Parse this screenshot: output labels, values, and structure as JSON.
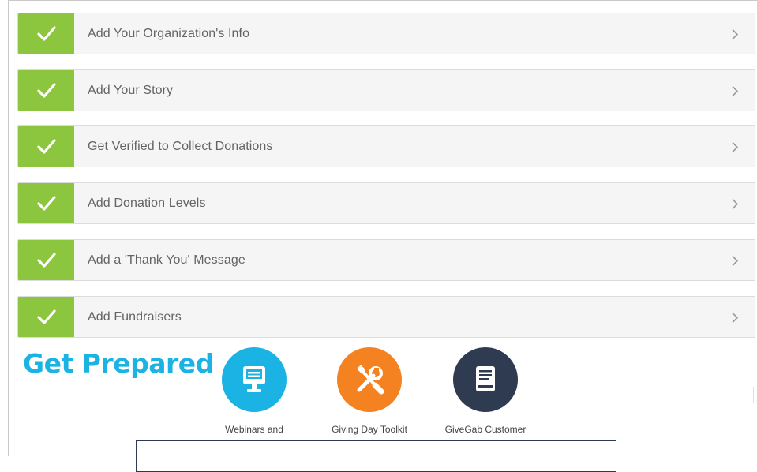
{
  "tasks": [
    {
      "label": "Add Your Organization's Info",
      "completed": true
    },
    {
      "label": "Add Your Story",
      "completed": true
    },
    {
      "label": "Get Verified to Collect Donations",
      "completed": true
    },
    {
      "label": "Add Donation Levels",
      "completed": true
    },
    {
      "label": "Add a 'Thank You' Message",
      "completed": true
    },
    {
      "label": "Add Fundraisers",
      "completed": true
    }
  ],
  "prepare": {
    "title": "Get Prepared",
    "resources": [
      {
        "label": "Webinars and",
        "icon": "monitor-icon",
        "color": "#1bb3e3"
      },
      {
        "label": "Giving Day Toolkit",
        "icon": "tools-icon",
        "color": "#f58220"
      },
      {
        "label": "GiveGab Customer",
        "icon": "book-icon",
        "color": "#2e3b50"
      }
    ]
  },
  "colors": {
    "check_green": "#8cc63f",
    "title_blue": "#1bb3e3",
    "row_bg": "#f5f5f5"
  }
}
